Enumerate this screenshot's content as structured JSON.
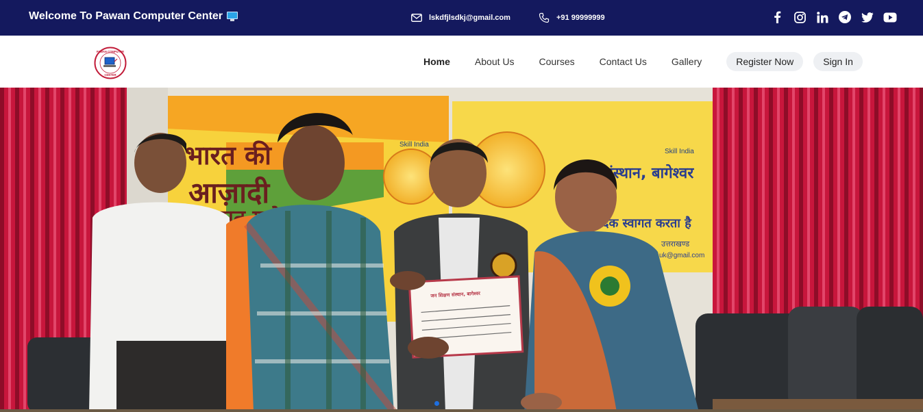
{
  "topbar": {
    "welcome": "Welcome To Pawan Computer Center",
    "welcome_icon": "computer-monitor-icon",
    "email": "lskdfjlsdkj@gmail.com",
    "phone": "+91 99999999",
    "background": "#14195e",
    "socials": [
      "facebook-icon",
      "instagram-icon",
      "linkedin-icon",
      "telegram-icon",
      "twitter-icon",
      "youtube-icon"
    ]
  },
  "header": {
    "logo_text_top": "PAWAN COMPUTER",
    "logo_text_bottom": "CENTER",
    "nav": [
      {
        "label": "Home",
        "active": true
      },
      {
        "label": "About Us"
      },
      {
        "label": "Courses"
      },
      {
        "label": "Contact Us"
      },
      {
        "label": "Gallery"
      }
    ],
    "register_label": "Register Now",
    "signin_label": "Sign In"
  },
  "hero": {
    "description": "photo-slide",
    "banner_left_line1": "भारत की",
    "banner_left_line2": "आज़ादी",
    "banner_left_line3": "अमृत महोत्सव",
    "skill_india": "Skill India",
    "banner_right_line1": "संस्थान, बागेश्वर",
    "banner_right_line2": "हार्दिक स्वागत करता है",
    "banner_right_line3": "उत्तराखण्ड",
    "banner_right_email": "uk@gmail.com",
    "certificate_title": "जन शिक्षण संस्थान, बागेश्वर",
    "slides_active": 1
  }
}
